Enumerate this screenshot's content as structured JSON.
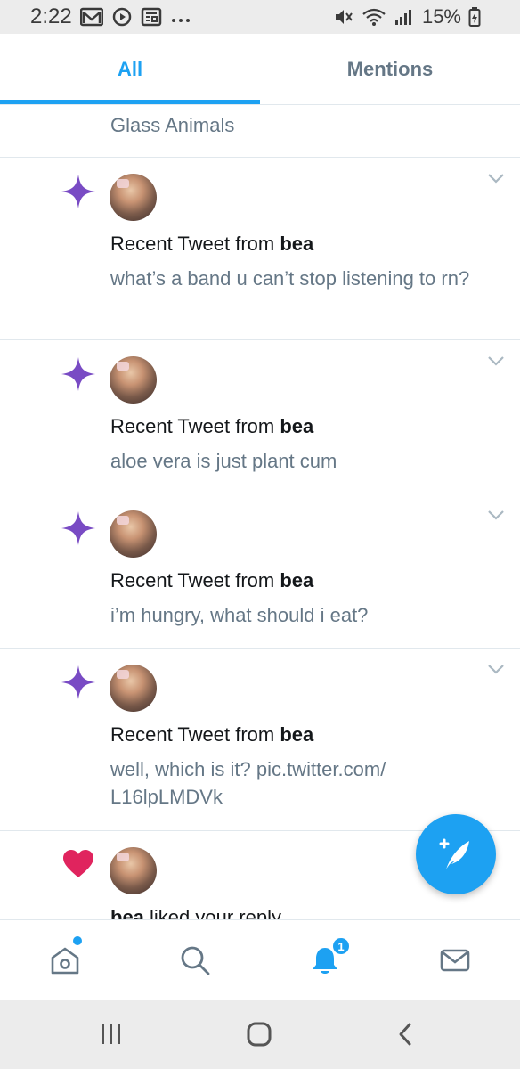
{
  "status_bar": {
    "time": "2:22",
    "battery": "15%",
    "left_icons": [
      "gmail-icon",
      "youtube-music-icon",
      "news-icon",
      "more-icon"
    ],
    "right_icons": [
      "mute-icon",
      "wifi-icon",
      "signal-icon",
      "battery-icon"
    ]
  },
  "tabs": [
    {
      "label": "All",
      "active": true
    },
    {
      "label": "Mentions",
      "active": false
    }
  ],
  "feed": {
    "partial_top_text": "Glass Animals",
    "items": [
      {
        "icon": "sparkle-icon",
        "title_prefix": "Recent Tweet from ",
        "user": "bea",
        "body": "what’s a band u can’t stop listening to rn?"
      },
      {
        "icon": "sparkle-icon",
        "title_prefix": "Recent Tweet from ",
        "user": "bea",
        "body": "aloe vera is just plant cum"
      },
      {
        "icon": "sparkle-icon",
        "title_prefix": "Recent Tweet from ",
        "user": "bea",
        "body": "i’m hungry, what should i eat?"
      },
      {
        "icon": "sparkle-icon",
        "title_prefix": "Recent Tweet from ",
        "user": "bea",
        "body": "well, which is it? pic.twitter.com/ L16lpLMDVk"
      }
    ],
    "partial_bottom": {
      "icon": "heart-icon",
      "user": "bea",
      "text": " liked your reply"
    }
  },
  "bottom_nav": {
    "items": [
      "home-icon",
      "search-icon",
      "notifications-icon",
      "messages-icon"
    ],
    "notification_count": "1"
  },
  "colors": {
    "accent": "#1da1f2",
    "sparkle": "#794bc4",
    "heart": "#e0245e",
    "secondary_text": "#657786"
  }
}
